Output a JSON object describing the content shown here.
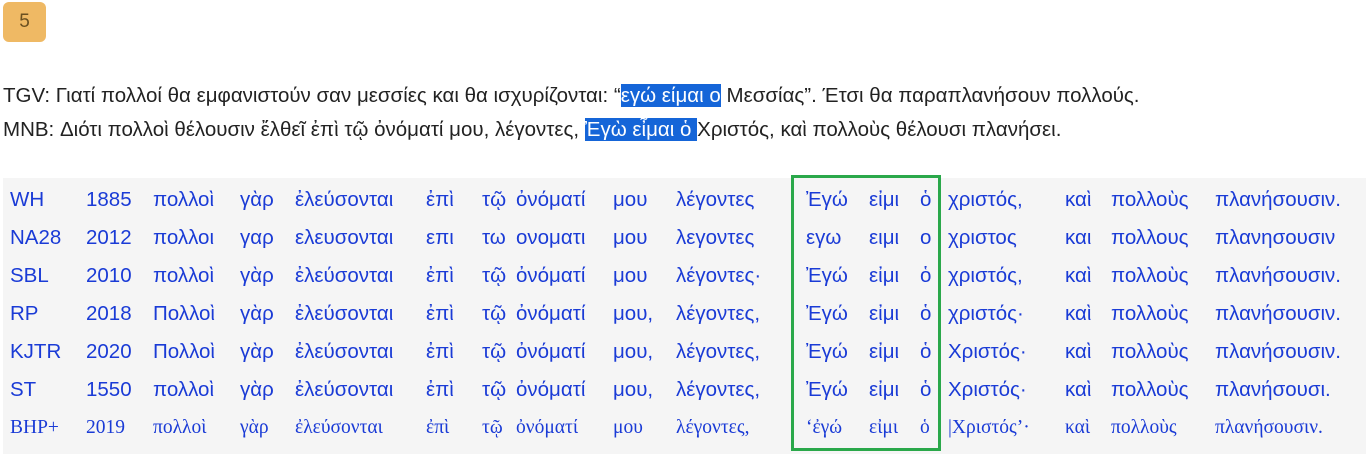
{
  "badge": "5",
  "translations": [
    {
      "pre": "TGV: Γιατί πολλοί θα εμφανιστούν σαν μεσσίες και θα ισχυρίζονται: “",
      "highlight": "εγώ είμαι ο",
      "post": " Μεσσίας”. Έτσι θα παραπλανήσουν πολλούς."
    },
    {
      "pre": "MNB: Διότι πολλοὶ θέλουσιν ἔλθεῖ ἐπὶ τῷ ὀνόματί μου, λέγοντες, ",
      "highlight": "Ἐγὼ εἶμαι ὁ ",
      "post": "Χριστός, καὶ πολλοὺς θέλουσι πλανήσει."
    }
  ],
  "rows": [
    {
      "ed": "WH",
      "year": "1885",
      "w": [
        "πολλοὶ",
        "γὰρ",
        "ἐλεύσονται",
        "ἐπὶ",
        "τῷ",
        "ὀνόματί",
        "μου",
        "λέγοντες",
        "Ἐγώ",
        "εἰμι",
        "ὁ",
        "χριστός,",
        "καὶ",
        "πολλοὺς",
        "πλανήσουσιν."
      ]
    },
    {
      "ed": "NA28",
      "year": "2012",
      "w": [
        "πολλοι",
        "γαρ",
        "ελευσονται",
        "επι",
        "τω",
        "ονοματι",
        "μου",
        "λεγοντες",
        "εγω",
        "ειμι",
        "ο",
        "χριστος",
        "και",
        "πολλους",
        "πλανησουσιν"
      ]
    },
    {
      "ed": "SBL",
      "year": "2010",
      "w": [
        "πολλοὶ",
        "γὰρ",
        "ἐλεύσονται",
        "ἐπὶ",
        "τῷ",
        "ὀνόματί",
        "μου",
        "λέγοντες·",
        "Ἐγώ",
        "εἰμι",
        "ὁ",
        "χριστός,",
        "καὶ",
        "πολλοὺς",
        "πλανήσουσιν."
      ]
    },
    {
      "ed": "RP",
      "year": "2018",
      "w": [
        "Πολλοὶ",
        "γὰρ",
        "ἐλεύσονται",
        "ἐπὶ",
        "τῷ",
        "ὀνόματί",
        "μου,",
        "λέγοντες,",
        "Ἐγώ",
        "εἰμι",
        "ὁ",
        "χριστός·",
        "καὶ",
        "πολλοὺς",
        "πλανήσουσιν."
      ]
    },
    {
      "ed": "KJTR",
      "year": "2020",
      "w": [
        "Πολλοὶ",
        "γὰρ",
        "ἐλεύσονται",
        "ἐπὶ",
        "τῷ",
        "ὀνόματί",
        "μου,",
        "λέγοντες,",
        "Ἐγώ",
        "εἰμι",
        "ὁ",
        "Χριστός·",
        "καὶ",
        "πολλοὺς",
        "πλανήσουσιν."
      ]
    },
    {
      "ed": "ST",
      "year": "1550",
      "w": [
        "πολλοὶ",
        "γὰρ",
        "ἐλεύσονται",
        "ἐπὶ",
        "τῷ",
        "ὀνόματί",
        "μου,",
        "λέγοντες,",
        "Ἐγώ",
        "εἰμι",
        "ὁ",
        "Χριστός·",
        "καὶ",
        "πολλοὺς",
        "πλανήσουσι."
      ]
    },
    {
      "ed": "BHP+",
      "year": "2019",
      "w": [
        "πολλοὶ",
        "γὰρ",
        "ἐλεύσονται",
        "ἐπὶ",
        "τῷ",
        "ὀνόματί",
        "μου",
        "λέγοντες,",
        "‘ἐγώ",
        "εἰμι",
        "ὁ",
        "|Χριστός’·",
        "καὶ",
        "πολλοὺς",
        "πλανήσουσιν."
      ]
    }
  ]
}
